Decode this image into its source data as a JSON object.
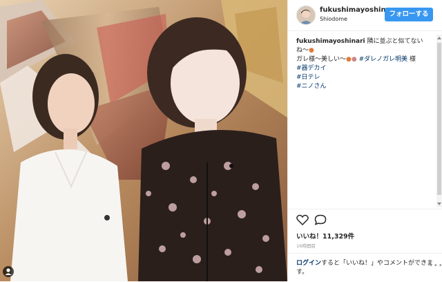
{
  "post": {
    "username": "fukushimayoshina",
    "location": "Shiodome",
    "follow_label": "フォローする",
    "caption_user": "fukushimayoshinari",
    "caption_line1": " 隣に並ぶと似てないね〜",
    "caption_line2": "ガレ様〜美しい〜",
    "caption_tag1": "#ダレノガレ明美",
    "caption_tag1_suffix": " 様",
    "caption_tag2": "#器デカイ",
    "caption_tag3": "#日テレ",
    "caption_tag4": "#ニノさん",
    "likes": "いいね！11,329件",
    "time": "16時間前",
    "login_link": "ログイン",
    "login_rest": "すると「いいね！」やコメントができます。",
    "more": "•••"
  },
  "colors": {
    "accent": "#3897f0",
    "tag": "#003569"
  },
  "icons": {
    "heart": "heart-icon",
    "comment": "comment-icon",
    "user_tag": "user-tag-icon",
    "more": "more-icon"
  }
}
